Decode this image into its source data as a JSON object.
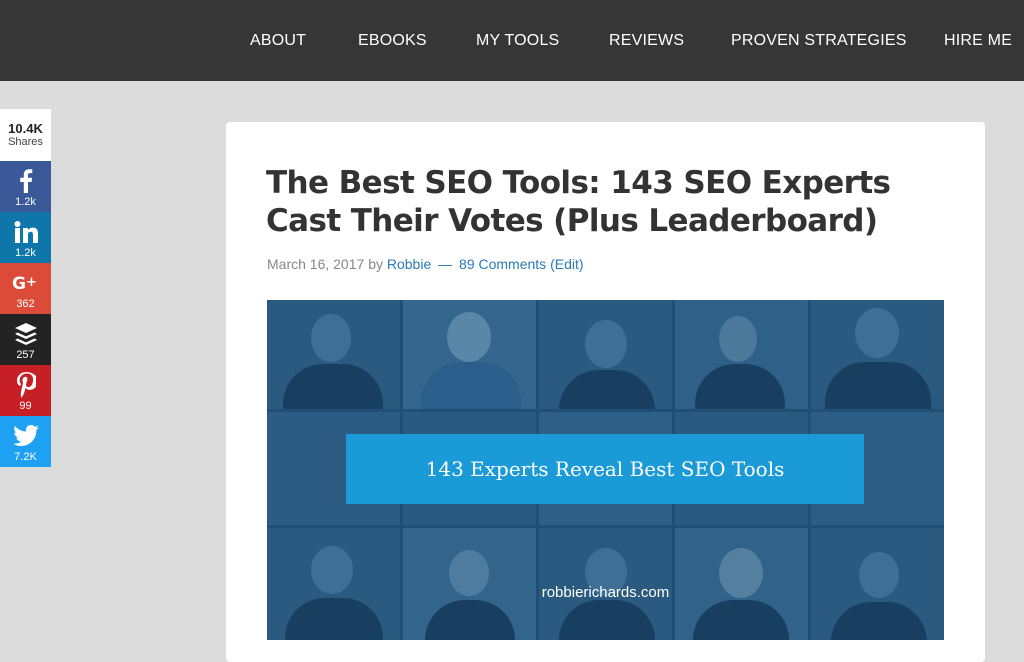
{
  "nav": {
    "items": [
      "ABOUT",
      "EBOOKS",
      "MY TOOLS",
      "REVIEWS",
      "PROVEN STRATEGIES",
      "HIRE ME"
    ]
  },
  "share": {
    "total": "10.4K",
    "total_label": "Shares",
    "buttons": [
      {
        "network": "facebook",
        "icon": "facebook-icon",
        "count": "1.2k",
        "color": "#3b5998"
      },
      {
        "network": "linkedin",
        "icon": "linkedin-icon",
        "count": "1.2k",
        "color": "#0e76a8"
      },
      {
        "network": "google-plus",
        "icon": "google-plus-icon",
        "count": "362",
        "color": "#dc4a38"
      },
      {
        "network": "buffer",
        "icon": "buffer-icon",
        "count": "257",
        "color": "#232323"
      },
      {
        "network": "pinterest",
        "icon": "pinterest-icon",
        "count": "99",
        "color": "#c61f26"
      },
      {
        "network": "twitter",
        "icon": "twitter-icon",
        "count": "7.2K",
        "color": "#1ea1f2"
      }
    ]
  },
  "article": {
    "title": "The Best SEO Tools: 143 SEO Experts Cast Their Votes (Plus Leaderboard)",
    "date": "March 16, 2017",
    "by": "by",
    "author": "Robbie",
    "dash": "—",
    "comments": "89 Comments",
    "edit": "(Edit)",
    "hero_banner": "143 Experts Reveal Best SEO Tools",
    "hero_site": "robbierichards.com"
  }
}
